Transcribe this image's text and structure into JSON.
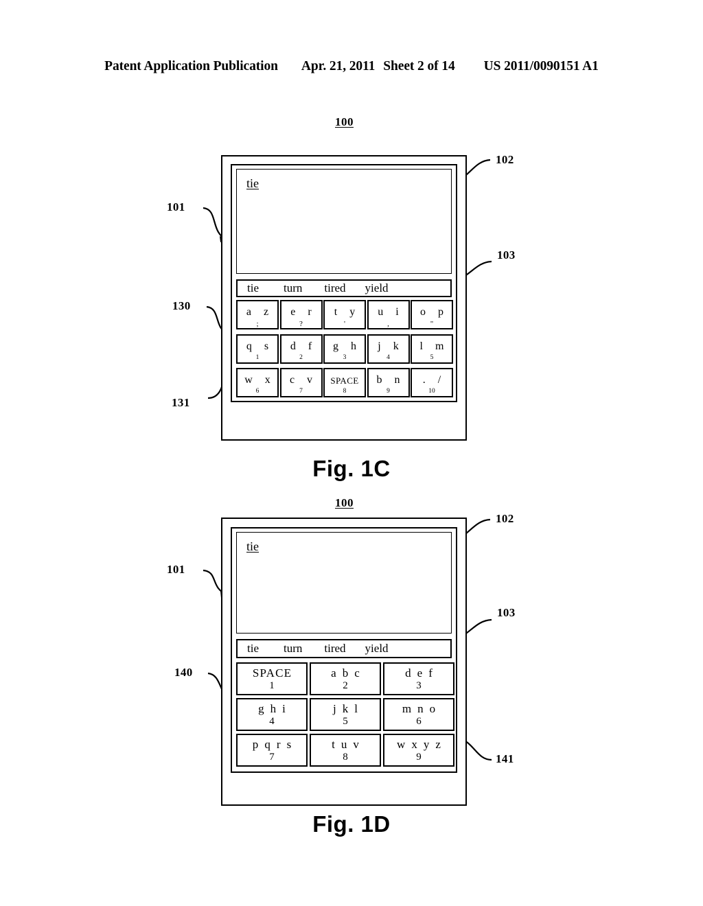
{
  "page_header": {
    "publication": "Patent Application Publication",
    "date": "Apr. 21, 2011",
    "sheet": "Sheet 2 of 14",
    "doc_number": "US 2011/0090151 A1"
  },
  "figures": [
    {
      "id": "fig-1c",
      "caption": "Fig. 1C",
      "device_ref": "100",
      "callouts": [
        {
          "label": "101",
          "target": "device-housing"
        },
        {
          "label": "102",
          "target": "text-display-area"
        },
        {
          "label": "103",
          "target": "suggestion-bar"
        },
        {
          "label": "130",
          "target": "reduced-keyboard"
        },
        {
          "label": "131",
          "target": "keyboard-bottom-row"
        }
      ],
      "text_area": {
        "value": "tie"
      },
      "suggestions": [
        "tie",
        "turn",
        "tired",
        "yield"
      ],
      "keyboard": {
        "ref": "130",
        "rows": [
          [
            {
              "glyphs": "a z",
              "sub": ";",
              "sub_kind": "punct"
            },
            {
              "glyphs": "e r",
              "sub": "?",
              "sub_kind": "punct"
            },
            {
              "glyphs": "t y",
              "sub": "'",
              "sub_kind": "punct"
            },
            {
              "glyphs": "u i",
              "sub": ",",
              "sub_kind": "punct"
            },
            {
              "glyphs": "o p",
              "sub": "\"",
              "sub_kind": "punct"
            }
          ],
          [
            {
              "glyphs": "q s",
              "sub": "1",
              "sub_kind": "digit"
            },
            {
              "glyphs": "d f",
              "sub": "2",
              "sub_kind": "digit"
            },
            {
              "glyphs": "g h",
              "sub": "3",
              "sub_kind": "digit"
            },
            {
              "glyphs": "j k",
              "sub": "4",
              "sub_kind": "digit"
            },
            {
              "glyphs": "l m",
              "sub": "5",
              "sub_kind": "digit"
            }
          ],
          [
            {
              "glyphs": "w x",
              "sub": "6",
              "sub_kind": "digit"
            },
            {
              "glyphs": "c v",
              "sub": "7",
              "sub_kind": "digit"
            },
            {
              "glyphs": "SPACE",
              "sub": "8",
              "sub_kind": "digit",
              "wide": true
            },
            {
              "glyphs": "b n",
              "sub": "9",
              "sub_kind": "digit"
            },
            {
              "glyphs": ". /",
              "sub": "10",
              "sub_kind": "digit"
            }
          ]
        ]
      }
    },
    {
      "id": "fig-1d",
      "caption": "Fig. 1D",
      "device_ref": "100",
      "callouts": [
        {
          "label": "101",
          "target": "device-housing"
        },
        {
          "label": "102",
          "target": "text-display-area"
        },
        {
          "label": "103",
          "target": "suggestion-bar"
        },
        {
          "label": "140",
          "target": "telephone-keypad"
        },
        {
          "label": "141",
          "target": "keypad-bottom-row"
        }
      ],
      "text_area": {
        "value": "tie"
      },
      "suggestions": [
        "tie",
        "turn",
        "tired",
        "yield"
      ],
      "keypad": {
        "ref": "140",
        "rows": [
          [
            {
              "letters": "SPACE",
              "digit": "1",
              "word": true
            },
            {
              "letters": "a b c",
              "digit": "2"
            },
            {
              "letters": "d e f",
              "digit": "3"
            }
          ],
          [
            {
              "letters": "g h i",
              "digit": "4"
            },
            {
              "letters": "j k l",
              "digit": "5"
            },
            {
              "letters": "m n o",
              "digit": "6"
            }
          ],
          [
            {
              "letters": "p q r s",
              "digit": "7"
            },
            {
              "letters": "t u v",
              "digit": "8"
            },
            {
              "letters": "w x y z",
              "digit": "9"
            }
          ]
        ]
      }
    }
  ],
  "colors": {
    "ink": "#000000",
    "paper": "#ffffff"
  }
}
